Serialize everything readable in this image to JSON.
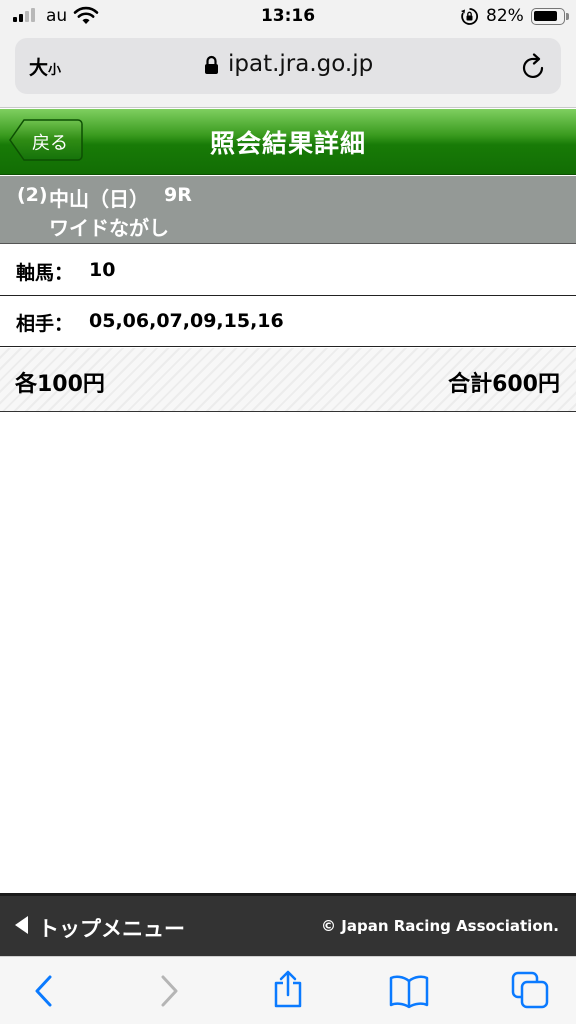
{
  "status_bar": {
    "carrier": "au",
    "time": "13:16",
    "battery_percent": "82%",
    "battery_level": 0.82
  },
  "browser": {
    "text_size_large": "大",
    "text_size_small": "小",
    "url": "ipat.jra.go.jp"
  },
  "header": {
    "back_label": "戻る",
    "title": "照会結果詳細",
    "accent_color": "#187b07"
  },
  "race": {
    "number": "(2)",
    "place": "中山（日）",
    "race_num": "9R",
    "bet_type": "ワイドながし"
  },
  "details": {
    "axis_label": "軸馬：",
    "axis_value": "10",
    "partner_label": "相手：",
    "partner_value": "05,06,07,09,15,16"
  },
  "amount": {
    "each": "各100円",
    "total": "合計600円"
  },
  "footer": {
    "top_menu": "トップメニュー",
    "copyright": "© Japan Racing Association."
  },
  "toolbar": {
    "icons": [
      "back-icon",
      "forward-icon",
      "share-icon",
      "bookmarks-icon",
      "tabs-icon"
    ],
    "tint_color": "#0a7aff"
  }
}
